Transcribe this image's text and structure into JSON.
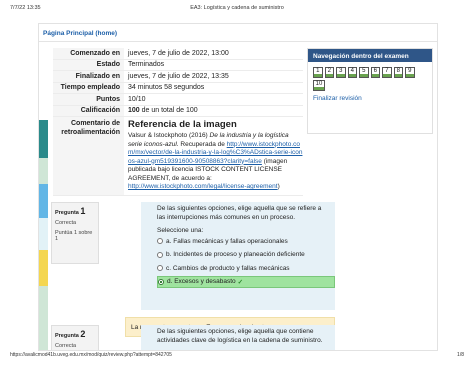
{
  "print": {
    "timestamp": "7/7/22 13:35",
    "title": "EA3: Logística y cadena de suministro",
    "url": "https://avalicmod41b.uveg.edu.mx/mod/quiz/review.php?attempt=842705",
    "page": "1/8"
  },
  "home_link": "Página Principal (home)",
  "summary": [
    {
      "label": "Comenzado en",
      "value": "jueves, 7 de julio de 2022, 13:00"
    },
    {
      "label": "Estado",
      "value": "Terminados"
    },
    {
      "label": "Finalizado en",
      "value": "jueves, 7 de julio de 2022, 13:35"
    },
    {
      "label": "Tiempo empleado",
      "value": "34 minutos 58 segundos"
    },
    {
      "label": "Puntos",
      "value": "10/10"
    },
    {
      "label": "Calificación",
      "value_bold": "100",
      "value_rest": " de un total de 100"
    }
  ],
  "feedback": {
    "label_line1": "Comentario de",
    "label_line2": "retroalimentación",
    "heading": "Referencia de la imagen",
    "citation_plain": "Valsur & Istockphoto (2016) ",
    "citation_italic": "De la industria y la logística serie iconos-azul",
    "citation_after": ". Recuperada de",
    "link1": "http://www.istockphoto.com/mx/vector/de-la-industria-y-la-log%C3%ADstica-serie-iconos-azul-gm519391600-90508863?clarity=false",
    "text_after_link1": " (imagen publicada bajo licencia ISTOCK CONTENT LICENSE AGREEMENT, de acuerdo a: ",
    "link2": "http://www.istockphoto.com/legal/license-agreement",
    "text_end": ")"
  },
  "nav": {
    "title": "Navegación dentro del examen",
    "buttons": [
      "1",
      "2",
      "3",
      "4",
      "5",
      "6",
      "7",
      "8",
      "9",
      "10"
    ],
    "finish": "Finalizar revisión"
  },
  "colors": {
    "strip": [
      "#2a8a8a",
      "#cfe6d6",
      "#62b6e6",
      "#e2f2f7",
      "#f4d650",
      "#cfe6d6"
    ],
    "nav_header": "#2f5688",
    "selected_option": "#9fe39f",
    "correct_feedback": "#fcefcb"
  },
  "q1": {
    "label": "Pregunta",
    "number": "1",
    "status": "Correcta",
    "points": "Puntúa 1 sobre 1",
    "text": "De las siguientes opciones, elige aquella que se refiere a las interrupciones más comunes en un proceso.",
    "prompt": "Seleccione una:",
    "options": [
      "a. Fallas mecánicas y fallas operacionales",
      "b. Incidentes de proceso y planeación deficiente",
      "c. Cambios de producto y fallas mecánicas",
      "d. Excesos y desabasto"
    ],
    "selected_check": "✓",
    "correct_answer": "La respuesta correcta es: Excesos y desabasto"
  },
  "q2": {
    "label": "Pregunta",
    "number": "2",
    "status": "Correcta",
    "text": "De las siguientes opciones, elige aquella que contiene actividades clave de logística en la cadena de suministro."
  }
}
